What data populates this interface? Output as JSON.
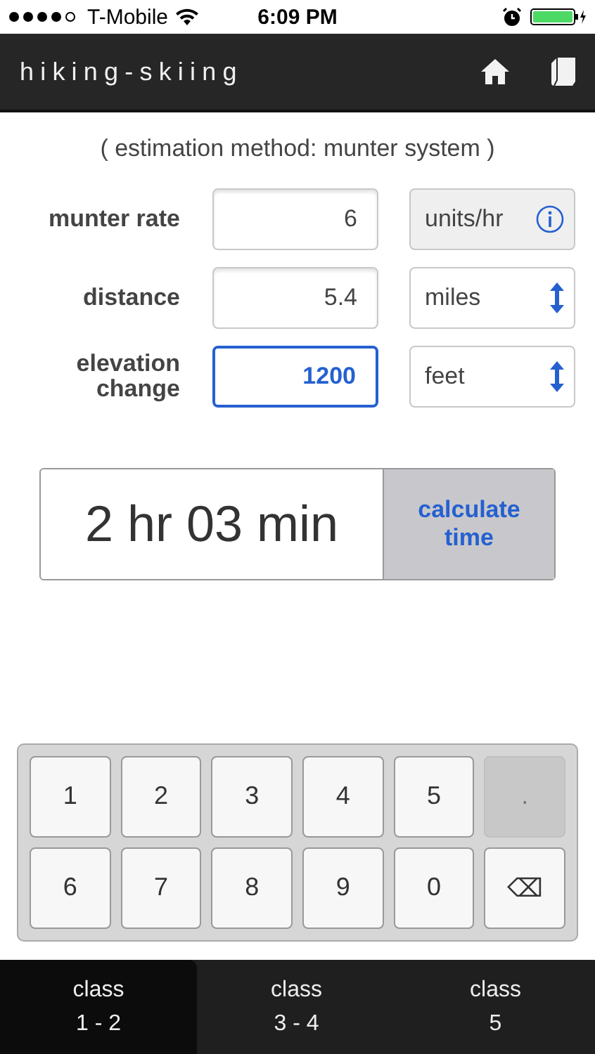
{
  "status_bar": {
    "carrier": "T-Mobile",
    "time": "6:09 PM"
  },
  "header": {
    "title": "hiking-skiing"
  },
  "subtitle": "( estimation method: munter system )",
  "fields": [
    {
      "label": "munter rate",
      "value": "6",
      "focused": false,
      "unit": "units/hr",
      "kind": "info"
    },
    {
      "label": "distance",
      "value": "5.4",
      "focused": false,
      "unit": "miles",
      "kind": "select"
    },
    {
      "label": "elevation change",
      "value": "1200",
      "focused": true,
      "unit": "feet",
      "kind": "select"
    }
  ],
  "result": {
    "value": "2 hr 03 min",
    "button": "calculate time"
  },
  "keypad": [
    {
      "label": "1",
      "disabled": false
    },
    {
      "label": "2",
      "disabled": false
    },
    {
      "label": "3",
      "disabled": false
    },
    {
      "label": "4",
      "disabled": false
    },
    {
      "label": "5",
      "disabled": false
    },
    {
      "label": ".",
      "disabled": true
    },
    {
      "label": "6",
      "disabled": false
    },
    {
      "label": "7",
      "disabled": false
    },
    {
      "label": "8",
      "disabled": false
    },
    {
      "label": "9",
      "disabled": false
    },
    {
      "label": "0",
      "disabled": false
    },
    {
      "label": "⌫",
      "disabled": false
    }
  ],
  "tabs": [
    {
      "line1": "class",
      "line2": "1 - 2",
      "selected": true
    },
    {
      "line1": "class",
      "line2": "3 - 4",
      "selected": false
    },
    {
      "line1": "class",
      "line2": "5",
      "selected": false
    }
  ]
}
